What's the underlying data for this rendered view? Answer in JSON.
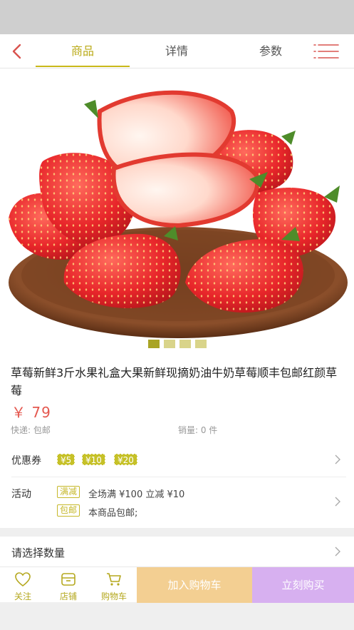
{
  "nav": {
    "tabs": [
      {
        "label": "商品",
        "active": true
      },
      {
        "label": "详情",
        "active": false
      },
      {
        "label": "参数",
        "active": false
      }
    ],
    "accent_color": "#c9b81a"
  },
  "carousel": {
    "total": 4,
    "active_index": 0
  },
  "product": {
    "title": "草莓新鲜3斤水果礼盒大果新鲜现摘奶油牛奶草莓顺丰包邮红颜草莓",
    "price": "￥ 79",
    "shipping": "快递: 包邮",
    "sales": "销量: 0 件",
    "price_color": "#e4584f"
  },
  "coupons": {
    "label": "优惠券",
    "items": [
      "¥5",
      "¥10",
      "¥20"
    ]
  },
  "activity": {
    "label": "活动",
    "items": [
      {
        "tag": "满减",
        "text": "全场满 ¥100 立减 ¥10"
      },
      {
        "tag": "包邮",
        "text": "本商品包邮;"
      }
    ]
  },
  "quantity": {
    "label": "请选择数量"
  },
  "bottom_bar": {
    "follow": "关注",
    "store": "店铺",
    "cart": "购物车",
    "add_to_cart": "加入购物车",
    "buy_now": "立刻购买"
  }
}
